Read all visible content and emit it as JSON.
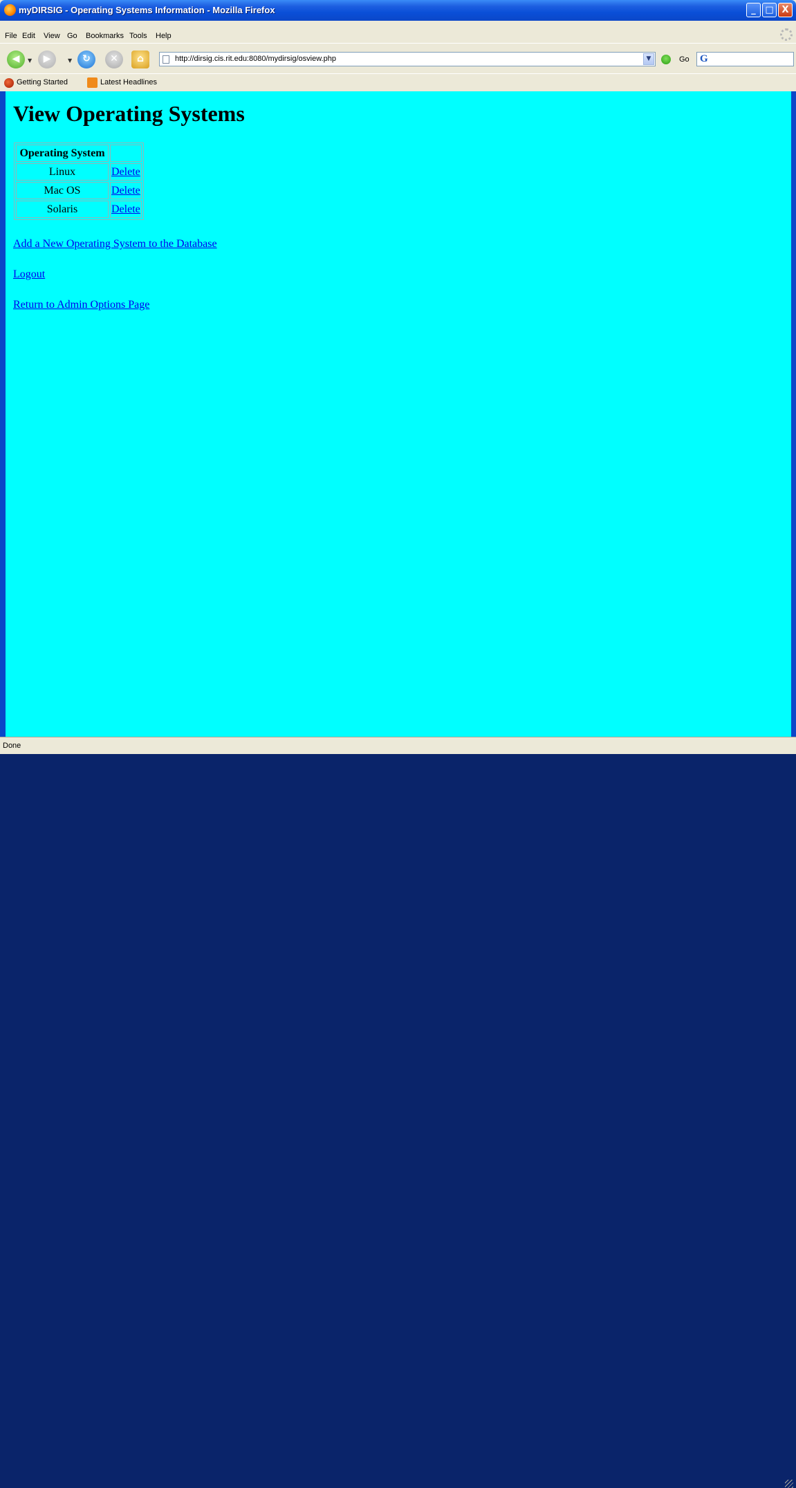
{
  "window": {
    "title": "myDIRSIG - Operating Systems Information - Mozilla Firefox",
    "buttons": {
      "minimize": "_",
      "maximize": "□",
      "close": "X"
    }
  },
  "menu": {
    "items": [
      "File",
      "Edit",
      "View",
      "Go",
      "Bookmarks",
      "Tools",
      "Help"
    ]
  },
  "navigation": {
    "url": "http://dirsig.cis.rit.edu:8080/mydirsig/osview.php",
    "go_label": "Go",
    "icons": [
      "back-icon",
      "forward-icon",
      "reload-icon",
      "stop-icon",
      "home-icon",
      "page-icon",
      "go-icon",
      "google-search-icon"
    ]
  },
  "bookmarks": {
    "items": [
      "Getting Started",
      "Latest Headlines"
    ]
  },
  "page": {
    "heading": "View Operating Systems",
    "table": {
      "header": "Operating System",
      "rows": [
        {
          "name": "Linux",
          "action": "Delete"
        },
        {
          "name": "Mac OS",
          "action": "Delete"
        },
        {
          "name": "Solaris",
          "action": "Delete"
        }
      ]
    },
    "links": {
      "add": "Add a New Operating System to the Database",
      "logout": "Logout",
      "return": "Return to Admin Options Page"
    },
    "background_color": "#00ffff",
    "link_color": "#0000ee"
  },
  "status": {
    "text": "Done"
  }
}
